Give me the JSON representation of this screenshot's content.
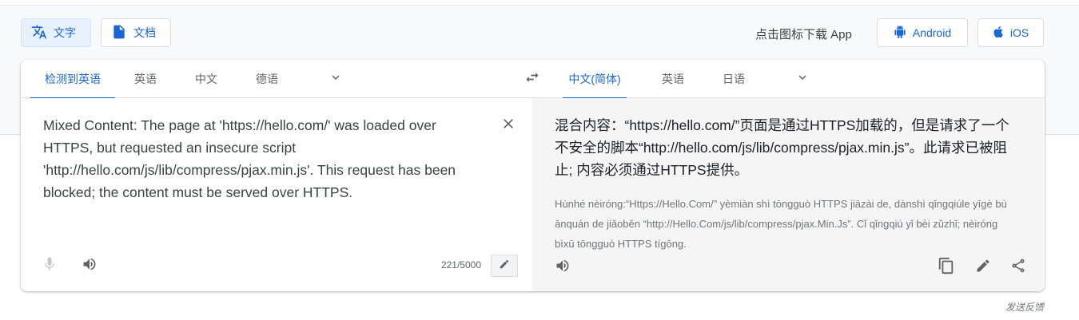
{
  "mode": {
    "text_label": "文字",
    "doc_label": "文档"
  },
  "download": {
    "label": "点击图标下载 App",
    "android": "Android",
    "ios": "iOS"
  },
  "source_langs": [
    "检测到英语",
    "英语",
    "中文",
    "德语"
  ],
  "target_langs": [
    "中文(简体)",
    "英语",
    "日语"
  ],
  "source": {
    "text": "Mixed Content: The page at 'https://hello.com/' was loaded over\nHTTPS, but requested an insecure script\n'http://hello.com/js/lib/compress/pjax.min.js'. This request has been\nblocked; the content must be served over HTTPS.",
    "char_count": "221/5000"
  },
  "translation": {
    "text": "混合内容：“https://hello.com/”页面是通过HTTPS加载的，但是请求了一个不安全的脚本“http://hello.com/js/lib/compress/pjax.min.js”。此请求已被阻止; 内容必须通过HTTPS提供。",
    "romanization": "Hùnhé nèiróng:“Https://Hello.Com/” yèmiàn shì tōngguò HTTPS jiāzài de, dànshì qǐngqiúle yīgè bù ānquán de jiǎoběn “http://Hello.Com/js/lib/compress/pjax.Min.Js”. Cǐ qǐngqiú yǐ bèi zǔzhǐ; nèiróng bìxū tōngguò HTTPS tígōng."
  },
  "feedback": "发送反馈",
  "colors": {
    "accent": "#1967d2",
    "target_bg": "#f5f5f5",
    "page_band": "#f8f9fa"
  },
  "icons": [
    "translate-icon",
    "document-icon",
    "android-icon",
    "apple-icon",
    "chevron-down-icon",
    "swap-icon",
    "close-icon",
    "microphone-icon",
    "speaker-icon",
    "pencil-icon",
    "copy-icon",
    "share-icon"
  ]
}
